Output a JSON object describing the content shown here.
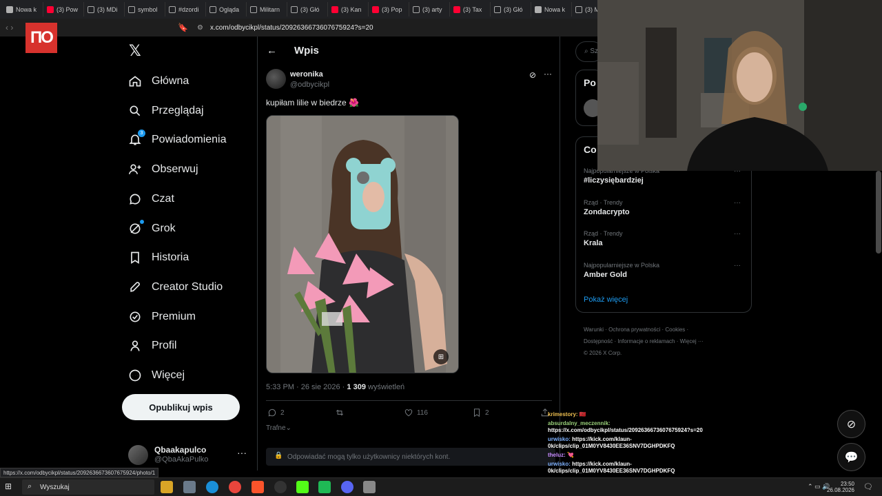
{
  "browser": {
    "tabs": [
      {
        "label": "Nowa k",
        "icon": "brave-icon",
        "color": "#b0b0b0"
      },
      {
        "label": "(3) Pow",
        "icon": "youtube-icon",
        "color": "#ff0033"
      },
      {
        "label": "(3) MDi",
        "icon": "x-icon",
        "color": "#ffffff"
      },
      {
        "label": "symbol",
        "icon": "google-icon",
        "color": "#ffffff"
      },
      {
        "label": "#dzordi",
        "icon": "tiktok-icon",
        "color": "#ffffff"
      },
      {
        "label": "Ogląda",
        "icon": "tiktok-icon",
        "color": "#ffffff"
      },
      {
        "label": "Militarn",
        "icon": "tiktok-icon",
        "color": "#ffffff"
      },
      {
        "label": "(3) Głó",
        "icon": "x-icon",
        "color": "#ffffff"
      },
      {
        "label": "(3) Kan",
        "icon": "youtube-icon",
        "color": "#ff0033"
      },
      {
        "label": "(3) Pop",
        "icon": "youtube-icon",
        "color": "#ff0033"
      },
      {
        "label": "(3) arty",
        "icon": "x-icon",
        "color": "#ffffff"
      },
      {
        "label": "(3) Tax",
        "icon": "youtube-icon",
        "color": "#ff0033"
      },
      {
        "label": "(3) Głó",
        "icon": "x-icon",
        "color": "#ffffff"
      },
      {
        "label": "Nowa k",
        "icon": "brave-icon",
        "color": "#b0b0b0"
      },
      {
        "label": "(3) M",
        "icon": "x-icon",
        "color": "#ffffff"
      }
    ],
    "url": "x.com/odbycikpl/status/2092636673607675924?s=20",
    "status_url": "https://x.com/odbycikpl/status/2092636673607675924/photo/1"
  },
  "sidebar": {
    "logo": "𝕏",
    "items": [
      {
        "label": "Główna",
        "icon": "home-icon"
      },
      {
        "label": "Przeglądaj",
        "icon": "search-icon"
      },
      {
        "label": "Powiadomienia",
        "icon": "bell-icon",
        "badge": "3"
      },
      {
        "label": "Obserwuj",
        "icon": "follow-icon"
      },
      {
        "label": "Czat",
        "icon": "chat-icon"
      },
      {
        "label": "Grok",
        "icon": "grok-icon"
      },
      {
        "label": "Historia",
        "icon": "bookmark-icon"
      },
      {
        "label": "Creator Studio",
        "icon": "rocket-icon"
      },
      {
        "label": "Premium",
        "icon": "verified-icon"
      },
      {
        "label": "Profil",
        "icon": "person-icon"
      },
      {
        "label": "Więcej",
        "icon": "more-circle-icon"
      }
    ],
    "post_button": "Opublikuj wpis",
    "account": {
      "name": "Qbaakapulco",
      "handle": "@QbaAkaPulko",
      "more": "···"
    }
  },
  "post": {
    "header_title": "Wpis",
    "author_name": "weronika",
    "author_handle": "@odbycikpl",
    "text": "kupiłam lilie w biedrze 🌺",
    "time": "5:33 PM · 26 sie 2026 · ",
    "views": "1 309",
    "views_label": " wyświetleń",
    "actions": {
      "replies": "2",
      "likes": "116",
      "bookmarks": "2"
    },
    "sort_label": "Trafne",
    "reply_restriction": "Odpowiadać mogą tylko użytkownicy niektórych kont."
  },
  "right": {
    "search_placeholder": "Sz",
    "box1_title": "Po",
    "trends_title": "Co",
    "trends": [
      {
        "category": "Najpopularniejsze w Polska",
        "name": "#liczysiębardziej"
      },
      {
        "category": "Rząd · Trendy",
        "name": "Zondacrypto"
      },
      {
        "category": "Rząd · Trendy",
        "name": "Krala"
      },
      {
        "category": "Najpopularniejsze w Polska",
        "name": "Amber Gold"
      }
    ],
    "show_more": "Pokaż więcej",
    "footer": {
      "line1": "Warunki  ·  Ochrona prywatności  ·  Cookies  ·",
      "line2": "Dostępność  ·  Informacje o reklamach  ·  Więcej ···",
      "line3": "© 2026 X Corp."
    }
  },
  "chat": [
    {
      "user": "krimestory:",
      "text": "🇲🇦",
      "color": "#f0c050"
    },
    {
      "user": "absurdalny_meczennik:",
      "text": "https://x.com/odbycikpl/status/2092636673607675924?s=20",
      "color": "#9ad17a"
    },
    {
      "user": "urwisko:",
      "text": "https://kick.com/klaun-0k/clips/clip_01M0YV8430EE36SNV7DGHPDKFQ",
      "color": "#7fb2ff"
    },
    {
      "user": "theluz:",
      "text": "💘",
      "color": "#c78bff"
    },
    {
      "user": "urwisko:",
      "text": "https://kick.com/klaun-0k/clips/clip_01M0YV8430EE36SNV7DGHPDKFQ",
      "color": "#7fb2ff"
    }
  ],
  "taskbar": {
    "search_label": "Wyszukaj",
    "time": "23:50",
    "date": "26.08.2026"
  },
  "overlay_logo": "ПО"
}
